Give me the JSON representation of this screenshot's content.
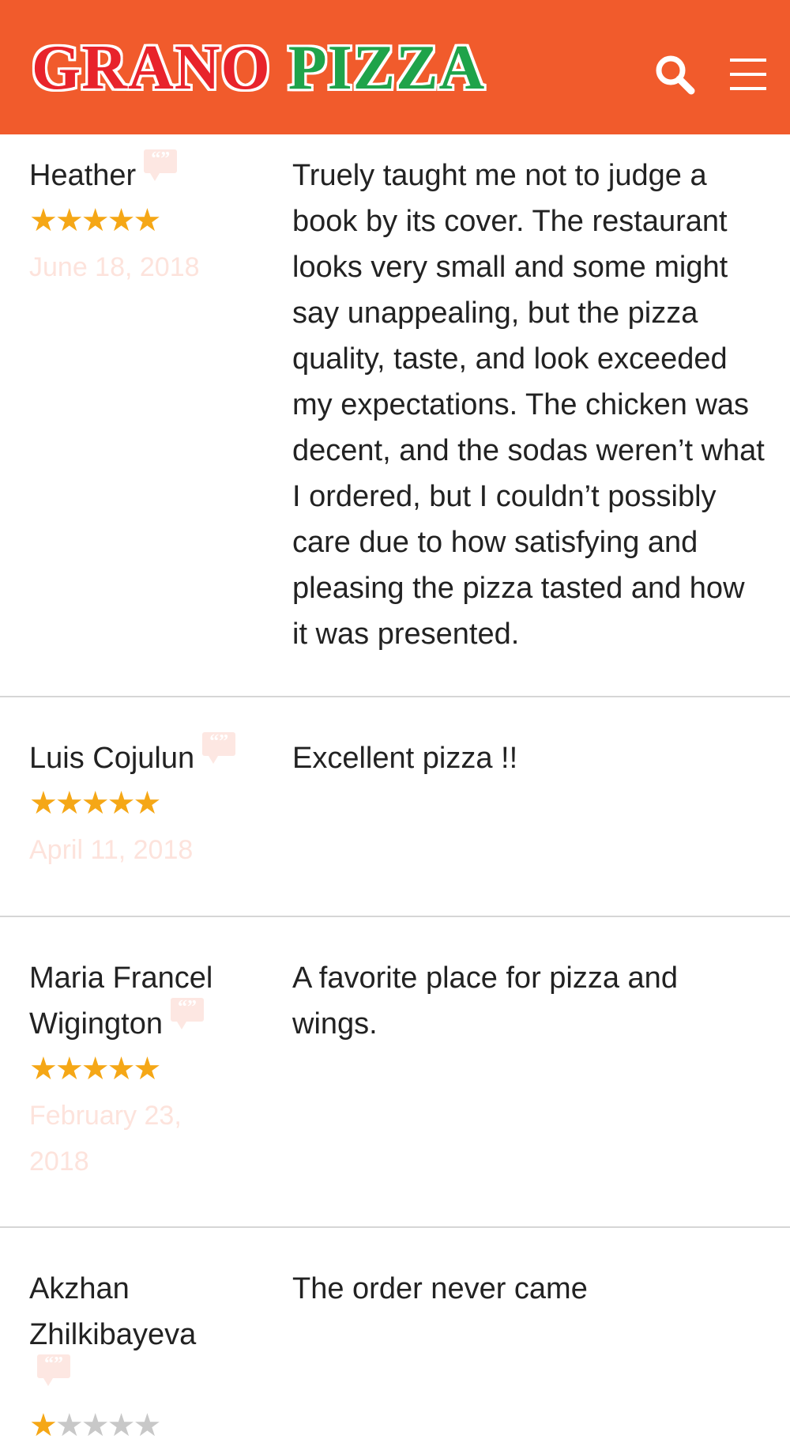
{
  "header": {
    "logo_word1": "GRANO",
    "logo_word2": "PIZZA",
    "bg_color": "#f15b2c",
    "logo_color_1": "#e8232b",
    "logo_color_2": "#1fa34a",
    "search_icon": "search-icon",
    "menu_icon": "hamburger-menu-icon"
  },
  "reviews": [
    {
      "name": "Heather",
      "rating": 5,
      "max_rating": 5,
      "date": "June 18, 2018",
      "text": "Truely taught me not to judge a book by its cover. The restaurant looks very small and some might say unappealing, but the pizza quality, taste, and look exceeded my expectations. The chicken was decent, and the sodas weren’t what I ordered, but I couldn’t possibly care due to how satisfying and pleasing the pizza tasted and how it was presented."
    },
    {
      "name": "Luis Cojulun",
      "rating": 5,
      "max_rating": 5,
      "date": "April 11, 2018",
      "text": "Excellent pizza !!"
    },
    {
      "name": "Maria Francel Wigington",
      "rating": 5,
      "max_rating": 5,
      "date": "February 23, 2018",
      "text": "A favorite place for pizza and wings."
    },
    {
      "name": "Akzhan Zhilkibayeva",
      "rating": 1,
      "max_rating": 5,
      "date": "",
      "text": "The order never came"
    }
  ],
  "colors": {
    "star_on": "#f5a716",
    "star_off": "#c8c8c8",
    "date_text": "#fde3dc",
    "quote_badge": "#fde7e2"
  }
}
